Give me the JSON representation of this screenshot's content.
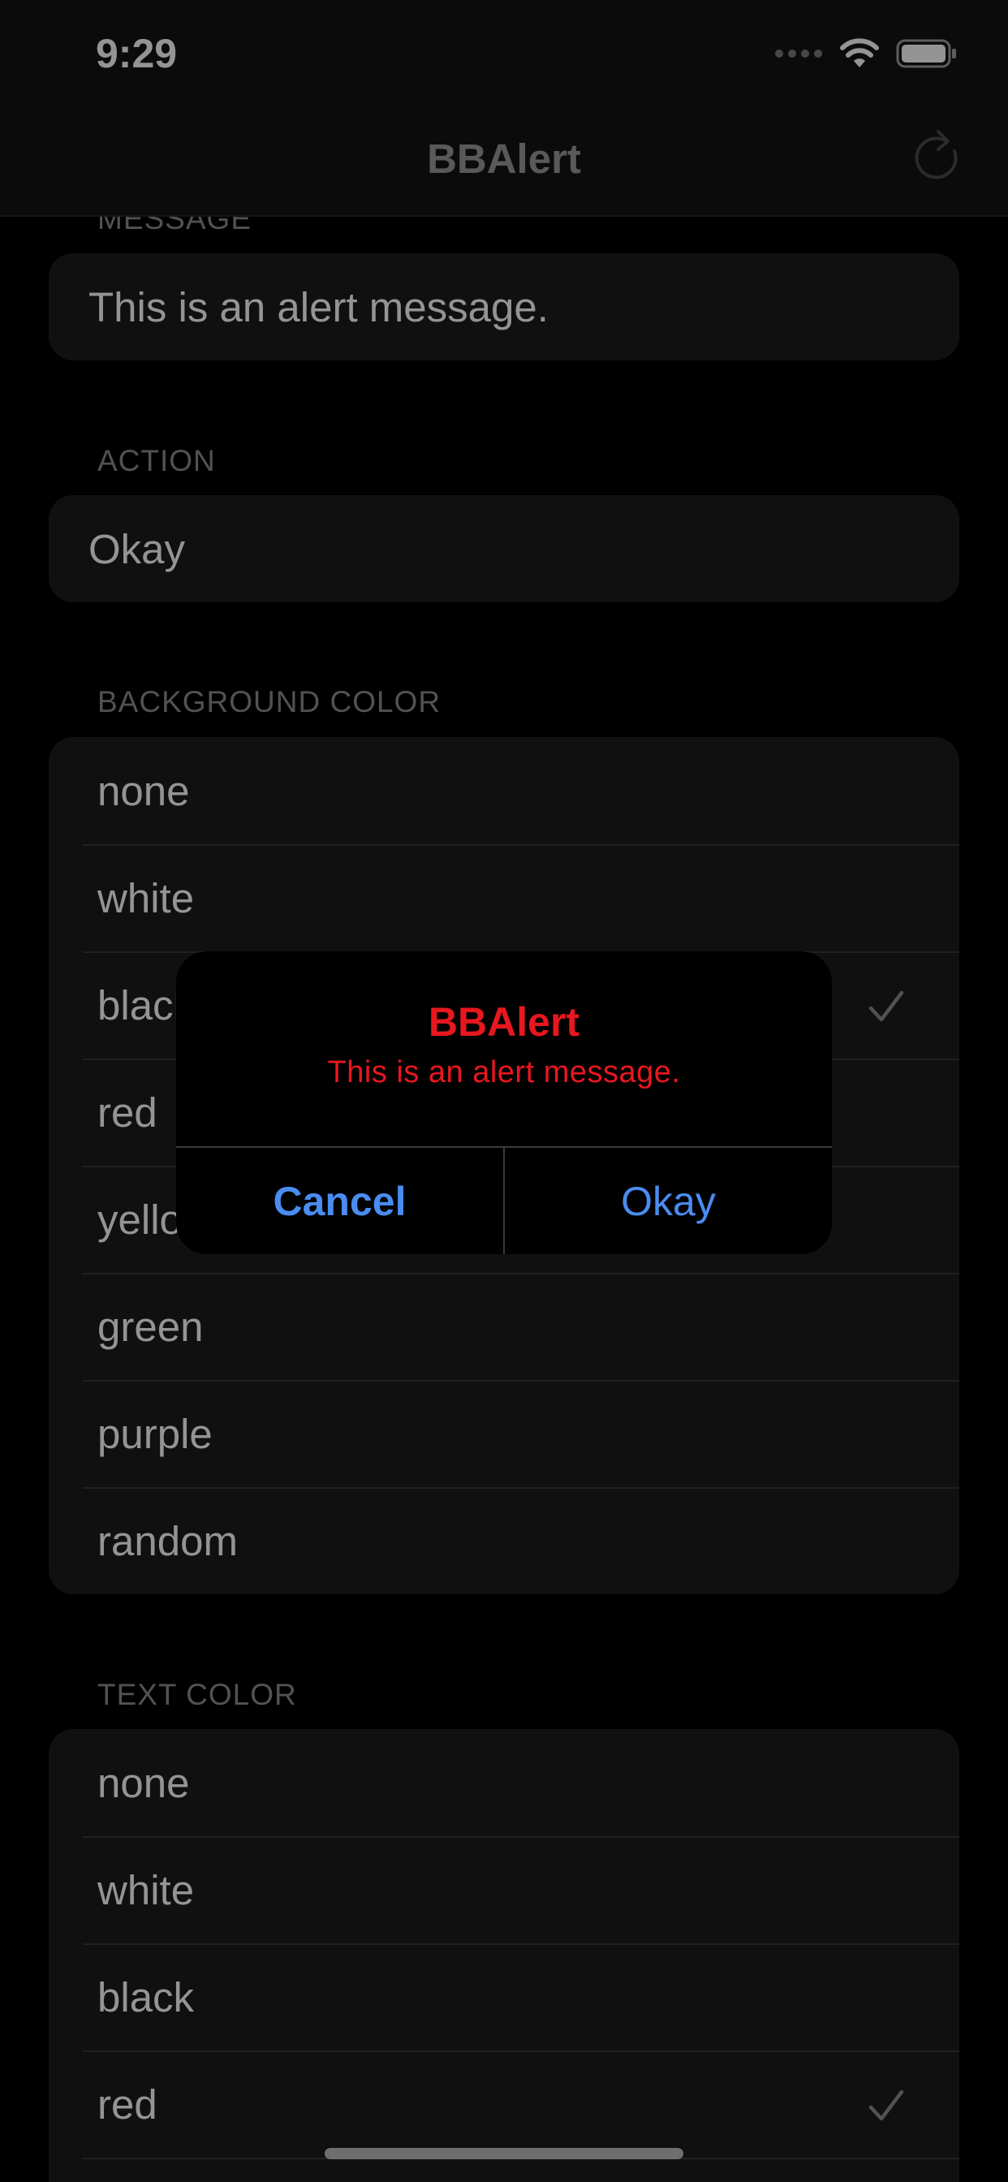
{
  "status_bar": {
    "time": "9:29",
    "icons": [
      "signal-dots-icon",
      "wifi-icon",
      "battery-icon"
    ]
  },
  "nav": {
    "title": "BBAlert",
    "refresh_icon": "refresh-icon"
  },
  "sections": {
    "message": {
      "header": "MESSAGE",
      "value": "This is an alert message."
    },
    "action": {
      "header": "ACTION",
      "value": "Okay"
    },
    "background_color": {
      "header": "BACKGROUND COLOR",
      "options": [
        "none",
        "white",
        "black",
        "red",
        "yellow",
        "green",
        "purple",
        "random"
      ],
      "selected": "black"
    },
    "text_color": {
      "header": "TEXT COLOR",
      "options": [
        "none",
        "white",
        "black",
        "red"
      ],
      "selected": "red"
    }
  },
  "alert": {
    "title": "BBAlert",
    "message": "This is an alert message.",
    "cancel_label": "Cancel",
    "okay_label": "Okay"
  },
  "colors": {
    "alert_text": "#e8171f",
    "button_blue": "#4a8cf0",
    "background": "#000000",
    "card": "#1c1c1e"
  }
}
